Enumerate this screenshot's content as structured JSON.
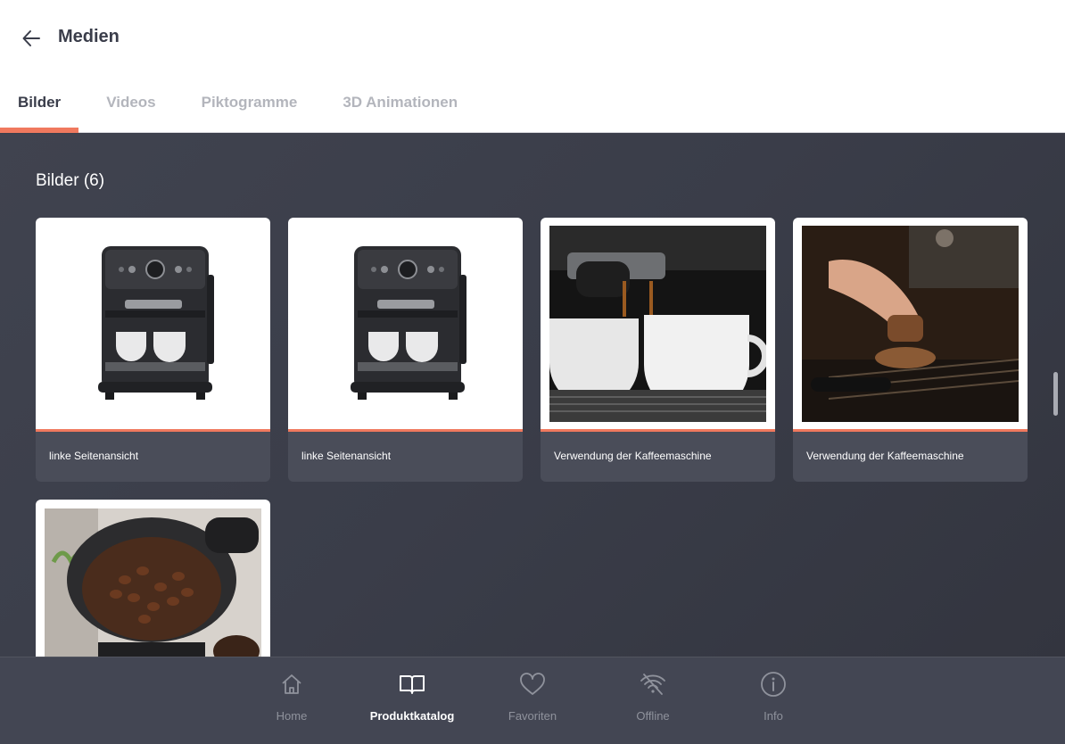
{
  "header": {
    "title": "Medien",
    "back_icon": "arrow-left-icon"
  },
  "tabs": [
    {
      "label": "Bilder",
      "active": true
    },
    {
      "label": "Videos",
      "active": false
    },
    {
      "label": "Piktogramme",
      "active": false
    },
    {
      "label": "3D Animationen",
      "active": false
    }
  ],
  "section": {
    "title": "Bilder (6)"
  },
  "cards": [
    {
      "label": "linke Seitenansicht",
      "image": "coffee-machine-product-photo"
    },
    {
      "label": "linke Seitenansicht",
      "image": "coffee-machine-product-photo"
    },
    {
      "label": "Verwendung der Kaffeemaschine",
      "image": "espresso-cups-photo"
    },
    {
      "label": "Verwendung der Kaffeemaschine",
      "image": "tamping-portafilter-photo"
    },
    {
      "label": "",
      "image": "coffee-beans-grinder-photo"
    }
  ],
  "nav": [
    {
      "label": "Home",
      "icon": "home-icon",
      "active": false
    },
    {
      "label": "Produktkatalog",
      "icon": "book-icon",
      "active": true
    },
    {
      "label": "Favoriten",
      "icon": "heart-icon",
      "active": false
    },
    {
      "label": "Offline",
      "icon": "wifi-off-icon",
      "active": false
    },
    {
      "label": "Info",
      "icon": "info-icon",
      "active": false
    }
  ],
  "colors": {
    "accent": "#f0795e",
    "background": "#3c3f4c",
    "nav": "#434653"
  }
}
